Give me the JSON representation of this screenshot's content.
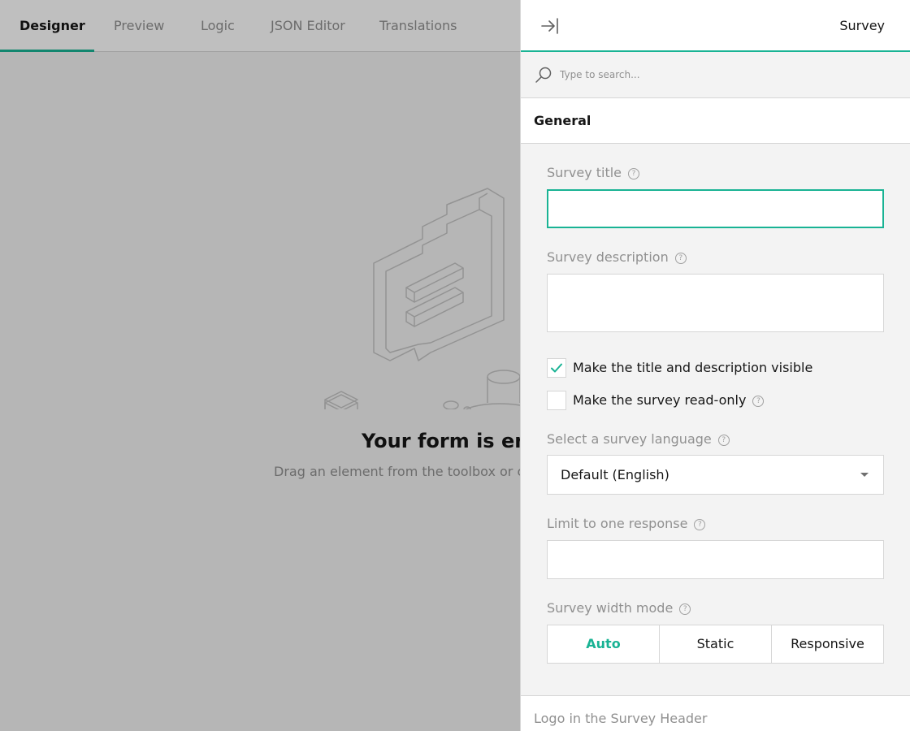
{
  "tabs": [
    {
      "label": "Designer",
      "active": true
    },
    {
      "label": "Preview",
      "active": false
    },
    {
      "label": "Logic",
      "active": false
    },
    {
      "label": "JSON Editor",
      "active": false
    },
    {
      "label": "Translations",
      "active": false
    }
  ],
  "empty_state": {
    "title": "Your form is empty",
    "subtitle": "Drag an element from the toolbox or click the \"Add Question\" button below."
  },
  "panel": {
    "title": "Survey",
    "search": {
      "placeholder": "Type to search...",
      "value": ""
    },
    "section": "General",
    "fields": {
      "survey_title": {
        "label": "Survey title",
        "value": ""
      },
      "survey_description": {
        "label": "Survey description",
        "value": ""
      },
      "show_title": {
        "label": "Make the title and description visible",
        "checked": true
      },
      "read_only": {
        "label": "Make the survey read-only",
        "checked": false
      },
      "language": {
        "label": "Select a survey language",
        "value": "Default (English)"
      },
      "limit_response": {
        "label": "Limit to one response",
        "value": ""
      },
      "width_mode": {
        "label": "Survey width mode",
        "options": [
          "Auto",
          "Static",
          "Responsive"
        ],
        "selected": "Auto"
      }
    },
    "next_section": "Logo in the Survey Header"
  },
  "colors": {
    "accent": "#19b394",
    "muted_text": "#909090",
    "border": "#d6d6d6",
    "panel_bg": "#f3f3f3"
  },
  "icons": {
    "collapse": "collapse-right-icon",
    "search": "search-icon",
    "help": "help-icon",
    "dropdown": "chevron-down-icon",
    "check": "check-icon"
  }
}
